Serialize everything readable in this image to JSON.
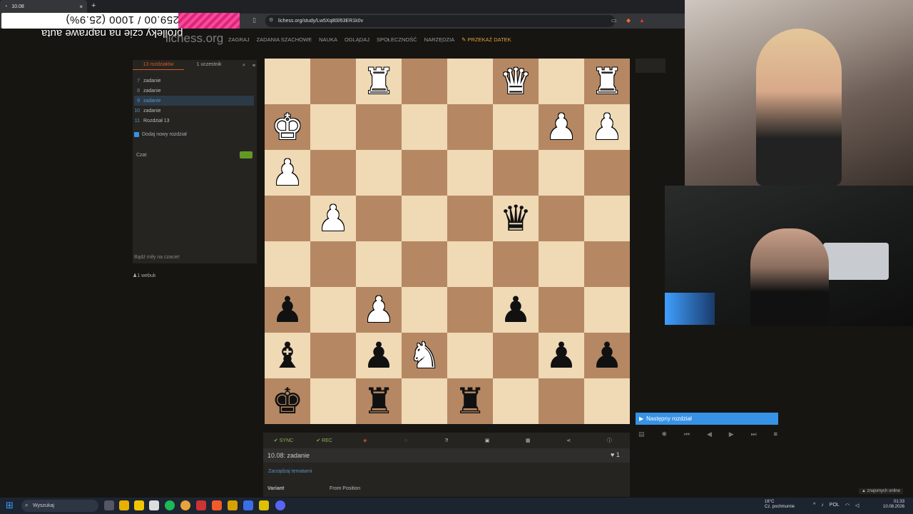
{
  "browser": {
    "tab_title": "10.08",
    "tab_close": "×",
    "new_tab": "+",
    "url": "lichess.org/study/Lw5Xq80l/63ER1k0v"
  },
  "overlay": {
    "goal_text": "259.00 / 1000 (25.9%)",
    "goal_fraction": 0.259,
    "caption": "prolleky czie na naprawe auta"
  },
  "site": {
    "logo": "lichess.org",
    "nav": [
      "ZAGRAJ",
      "ZADANIA SZACHOWE",
      "NAUKA",
      "OGLĄDAJ",
      "SPOŁECZNOŚĆ",
      "NARZĘDZIA"
    ],
    "gift": "PRZEKAŻ DATEK"
  },
  "study": {
    "tab_chapters": "13 rozdziałów",
    "tab_members": "1 uczestnik",
    "chapters": [
      {
        "n": "7",
        "title": "zadanie"
      },
      {
        "n": "8",
        "title": "zadanie"
      },
      {
        "n": "9",
        "title": "zadanie"
      },
      {
        "n": "10",
        "title": "zadanie"
      },
      {
        "n": "11",
        "title": "Rozdział 13"
      }
    ],
    "add_chapter": "Dodaj nowy rozdział",
    "chat_label": "Czat",
    "chat_placeholder": "Bądź miły na czacie!",
    "member": "webuk",
    "member_count": "1"
  },
  "board": {
    "light_color": "#f0d9b5",
    "dark_color": "#b58863",
    "rows": [
      [
        "",
        "",
        "wR",
        "",
        "",
        "wQ",
        "",
        "wR"
      ],
      [
        "wK",
        "",
        "",
        "",
        "",
        "",
        "wP",
        "wP"
      ],
      [
        "wP",
        "",
        "",
        "",
        "",
        "",
        "",
        ""
      ],
      [
        "",
        "wP",
        "",
        "",
        "",
        "bQ",
        "",
        ""
      ],
      [
        "",
        "",
        "",
        "",
        "",
        "",
        "",
        ""
      ],
      [
        "bP",
        "",
        "wP",
        "",
        "",
        "bP",
        "",
        ""
      ],
      [
        "bB",
        "",
        "bP",
        "wN",
        "",
        "",
        "bP",
        "bP"
      ],
      [
        "bK",
        "",
        "bR",
        "",
        "bR",
        "",
        "",
        ""
      ]
    ]
  },
  "tools": {
    "sync": "SYNC",
    "rec": "REC"
  },
  "chapter_info": {
    "title": "10.08: zadanie",
    "likes": "1",
    "topics_link": "Zarządzaj tematami",
    "variant_label": "Variant",
    "variant_value": "From Position"
  },
  "right": {
    "next_chapter": "Następny rozdział",
    "friends": "znajomych online"
  },
  "taskbar": {
    "search": "Wyszukaj",
    "weather_temp": "16°C",
    "weather_desc": "Cz. pochmurnie",
    "lang": "POL",
    "time": "01:33",
    "date": "10.08.2026"
  }
}
